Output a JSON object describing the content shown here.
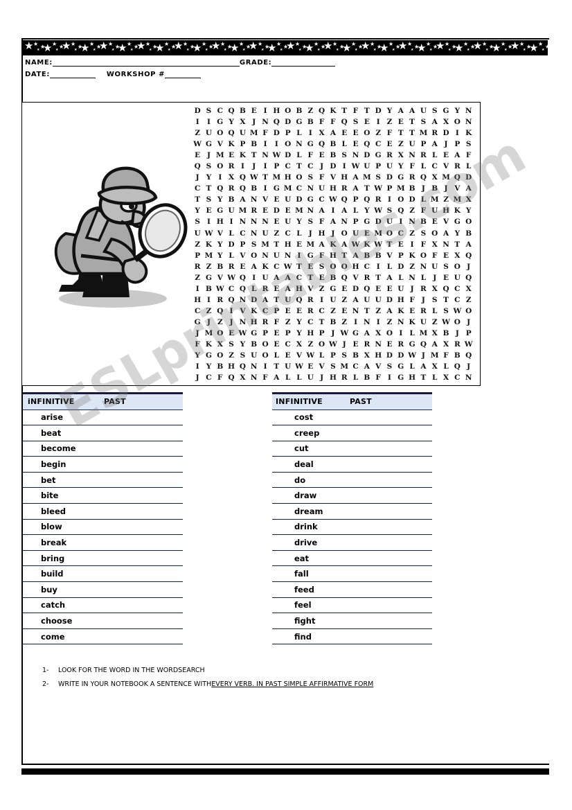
{
  "worksheet": {
    "header": {
      "name_label": "NAME:",
      "grade_label": "GRADE:",
      "date_label": "DATE:",
      "workshop_label": "WORKSHOP #"
    },
    "watermark": "ESLprintables.com",
    "illustration": "detective-with-magnifying-glass"
  },
  "wordsearch": {
    "rows": 24,
    "cols": 24,
    "grid": [
      "D S C Q B E I H O B Z Q K T F T D Y A A U S G Y N",
      "I I G Y X J N Q D G B F F Q S E I Z E T S A X O N",
      "Z U O Q U M F D P L I X A E E O Z F T T M R D I K",
      "W G V K P B I I O N G Q B L E Q C E Z U P A J P S",
      "E J M E K T N W D L F E B S N D G R X N R L E A F",
      "Q S O R I J I P C T C J D I W U P U Y F L C V R L",
      "J Y I X Q W T M H O S F V H A M S D G R Q X M Q D",
      "C T Q R Q B I G M C N U H R A T W P M B J B J V A",
      "T S Y B A N V E U D G C W Q P Q R I O D L M Z M X",
      "Y E G U M R E D E M N A I A L Y W S Q Z F U H K Y",
      "S I H I N N N E U Y S F A N P G D U I N B E V G O",
      "U W V L C N U Z C L J H J O U E M O C Z S O A Y B",
      "Z K Y D P S M T H E M A K A W K W T E I F X N T A",
      "P M Y L V O N U N I G F H T A B B V P K O F E X Q",
      "R Z B R E A K C W T E S O O H C I L D Z N U S O J",
      "Z G V W Q I U A A C T E B Q V R T A L N L J E U Q",
      "I B W C Q L R E A H V Z G E D Q E E U J R X Q C X",
      "H I R Q N D A T U Q R I U Z A U U D H F J S T C Z",
      "C Z Q I V K C P E E R C Z E N T Z A K E R L S W O",
      "G J Z J N H R F Z Y C T B Z I N I Z N K U Z W O J",
      "J M O E W G P E P Y H P J W G A X O I L M X B J P",
      "F K X S Y B O E C X Z O W J E R N E R G Q A X R W",
      "Y G O Z S U O L E V W L P S B X H D D W J M F B Q",
      "I Y B H Q N I T U W E V S M C A V S G L A X L Q J",
      "J C F Q X N F A L L U J H R L B F I G H T L X C N"
    ]
  },
  "verb_tables": {
    "left": {
      "header_infinitive": "iNFINITIVE",
      "header_past": "PAST",
      "rows": [
        {
          "infinitive": "arise",
          "past": ""
        },
        {
          "infinitive": "beat",
          "past": ""
        },
        {
          "infinitive": "become",
          "past": ""
        },
        {
          "infinitive": "begin",
          "past": ""
        },
        {
          "infinitive": "bet",
          "past": ""
        },
        {
          "infinitive": "bite",
          "past": ""
        },
        {
          "infinitive": "bleed",
          "past": ""
        },
        {
          "infinitive": "blow",
          "past": ""
        },
        {
          "infinitive": "break",
          "past": ""
        },
        {
          "infinitive": "bring",
          "past": ""
        },
        {
          "infinitive": "build",
          "past": ""
        },
        {
          "infinitive": "buy",
          "past": ""
        },
        {
          "infinitive": "catch",
          "past": ""
        },
        {
          "infinitive": "choose",
          "past": ""
        },
        {
          "infinitive": "come",
          "past": ""
        }
      ]
    },
    "right": {
      "header_infinitive": "INFINITIVE",
      "header_past": "PAST",
      "rows": [
        {
          "infinitive": "cost",
          "past": ""
        },
        {
          "infinitive": "creep",
          "past": ""
        },
        {
          "infinitive": "cut",
          "past": ""
        },
        {
          "infinitive": "deal",
          "past": ""
        },
        {
          "infinitive": "do",
          "past": ""
        },
        {
          "infinitive": "draw",
          "past": ""
        },
        {
          "infinitive": "dream",
          "past": ""
        },
        {
          "infinitive": "drink",
          "past": ""
        },
        {
          "infinitive": "drive",
          "past": ""
        },
        {
          "infinitive": "eat",
          "past": ""
        },
        {
          "infinitive": "fall",
          "past": ""
        },
        {
          "infinitive": "feed",
          "past": ""
        },
        {
          "infinitive": "feel",
          "past": ""
        },
        {
          "infinitive": "fight",
          "past": ""
        },
        {
          "infinitive": "find",
          "past": ""
        }
      ]
    }
  },
  "instructions": [
    {
      "number": "1-",
      "plain": "LOOK FOR THE WORD IN THE WORDSEARCH",
      "underlined": ""
    },
    {
      "number": "2-",
      "plain": "WRITE IN YOUR NOTEBOOK A SENTENCE WITH ",
      "underlined": "EVERY VERB. IN PAST SIMPLE AFFIRMATIVE FORM"
    }
  ],
  "colors": {
    "header_fill": "#dce6f4",
    "rule": "#10203c",
    "ink": "#000000"
  }
}
